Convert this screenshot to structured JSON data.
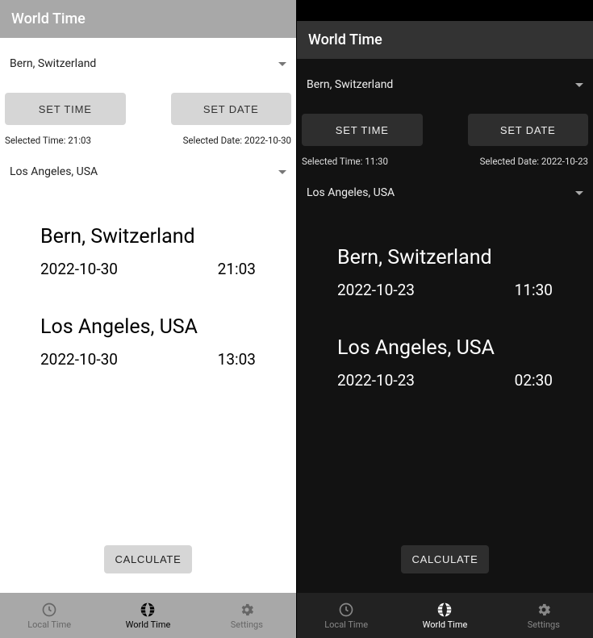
{
  "left": {
    "header_title": "World Time",
    "dropdown1": "Bern, Switzerland",
    "set_time_label": "SET TIME",
    "set_date_label": "SET DATE",
    "selected_time_label": "Selected Time: 21:03",
    "selected_date_label": "Selected Date: 2022-10-30",
    "dropdown2": "Los Angeles, USA",
    "result1_city": "Bern, Switzerland",
    "result1_date": "2022-10-30",
    "result1_time": "21:03",
    "result2_city": "Los Angeles, USA",
    "result2_date": "2022-10-30",
    "result2_time": "13:03",
    "calculate_label": "CALCULATE",
    "nav_local": "Local Time",
    "nav_world": "World Time",
    "nav_settings": "Settings"
  },
  "right": {
    "header_title": "World Time",
    "dropdown1": "Bern, Switzerland",
    "set_time_label": "SET TIME",
    "set_date_label": "SET DATE",
    "selected_time_label": "Selected Time: 11:30",
    "selected_date_label": "Selected Date: 2022-10-23",
    "dropdown2": "Los Angeles, USA",
    "result1_city": "Bern, Switzerland",
    "result1_date": "2022-10-23",
    "result1_time": "11:30",
    "result2_city": "Los Angeles, USA",
    "result2_date": "2022-10-23",
    "result2_time": "02:30",
    "calculate_label": "CALCULATE",
    "nav_local": "Local Time",
    "nav_world": "World Time",
    "nav_settings": "Settings"
  }
}
